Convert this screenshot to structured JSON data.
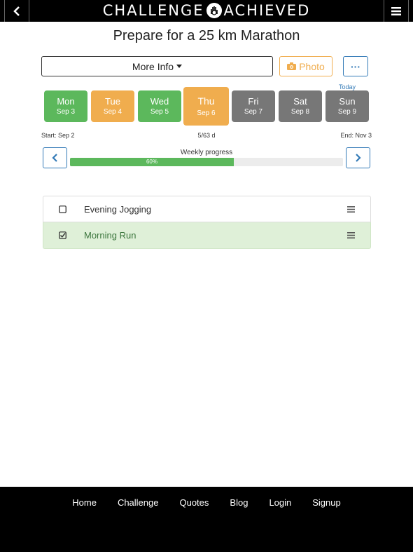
{
  "header": {
    "brand_left": "CHALLENGE",
    "brand_right": "ACHIEVED",
    "back_icon": "chevron-left-icon",
    "menu_icon": "hamburger-icon"
  },
  "title": "Prepare for a 25 km Marathon",
  "actions": {
    "more_info_label": "More Info",
    "photo_label": "Photo",
    "more_label": "···"
  },
  "today_label": "Today",
  "days": [
    {
      "name": "Mon",
      "date": "Sep 3",
      "status": "green"
    },
    {
      "name": "Tue",
      "date": "Sep 4",
      "status": "orange"
    },
    {
      "name": "Wed",
      "date": "Sep 5",
      "status": "green"
    },
    {
      "name": "Thu",
      "date": "Sep 6",
      "status": "orange",
      "selected": true
    },
    {
      "name": "Fri",
      "date": "Sep 7",
      "status": "grey"
    },
    {
      "name": "Sat",
      "date": "Sep 8",
      "status": "grey"
    },
    {
      "name": "Sun",
      "date": "Sep 9",
      "status": "grey",
      "today": true
    }
  ],
  "stats": {
    "start": "Start: Sep 2",
    "progress_days": "5/63 d",
    "end": "End: Nov 3"
  },
  "weekly_progress": {
    "label": "Weekly progress",
    "percent": 60,
    "percent_text": "60%"
  },
  "tasks": [
    {
      "label": "Evening Jogging",
      "done": false
    },
    {
      "label": "Morning Run",
      "done": true
    }
  ],
  "footer": {
    "links": [
      "Home",
      "Challenge",
      "Quotes",
      "Blog",
      "Login",
      "Signup"
    ]
  },
  "colors": {
    "green": "#5cb85c",
    "orange": "#f0ad4e",
    "grey": "#777777",
    "primary": "#337ab7"
  }
}
